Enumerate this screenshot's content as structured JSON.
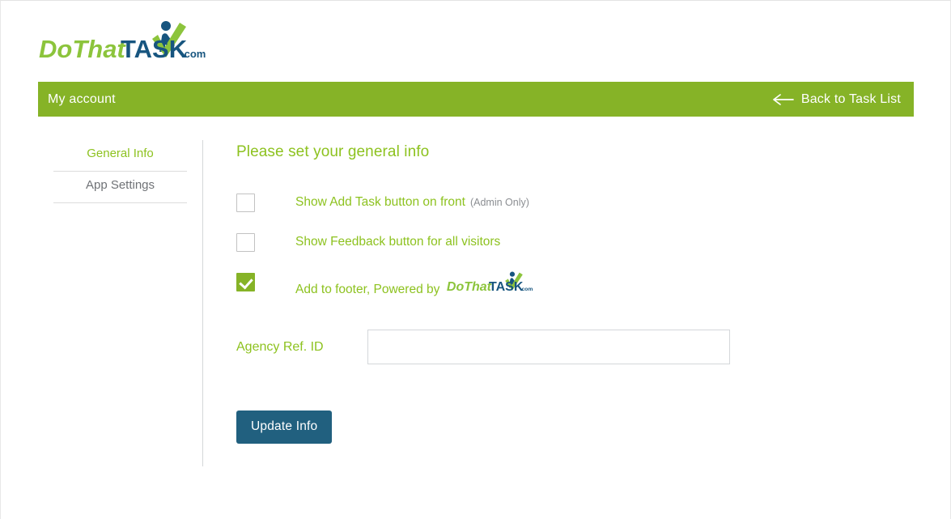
{
  "brand": {
    "logo_text_part1": "DoThat",
    "logo_text_part2": "TASK",
    "logo_suffix": ".com",
    "green": "#8cc43c",
    "navy": "#17557f"
  },
  "account_bar": {
    "title": "My account",
    "back_label": "Back to Task List",
    "back_icon": "arrow-left-icon",
    "background": "#86b327"
  },
  "sidebar": {
    "items": [
      {
        "label": "General Info",
        "active": true
      },
      {
        "label": "App Settings",
        "active": false
      }
    ]
  },
  "main": {
    "heading": "Please set your general info",
    "checkboxes": [
      {
        "label": "Show Add Task button on front",
        "note": "(Admin Only)",
        "checked": false,
        "has_logo": false
      },
      {
        "label": "Show Feedback button for all visitors",
        "note": "",
        "checked": false,
        "has_logo": false
      },
      {
        "label": "Add to footer, Powered by",
        "note": "",
        "checked": true,
        "has_logo": true
      }
    ],
    "field": {
      "label": "Agency Ref. ID",
      "value": "",
      "placeholder": ""
    },
    "submit_label": "Update Info",
    "submit_color": "#21607f"
  }
}
